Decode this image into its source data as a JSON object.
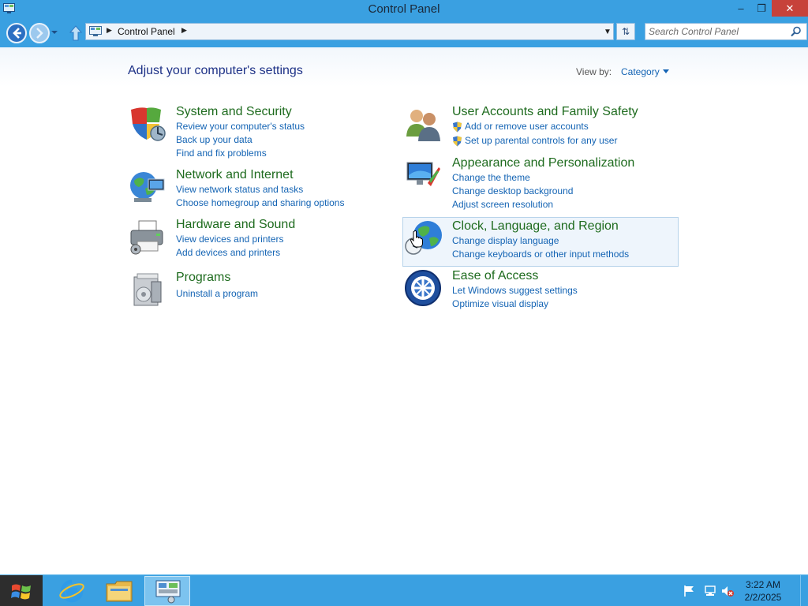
{
  "window": {
    "title": "Control Panel",
    "minimize_label": "–",
    "maximize_label": "❐",
    "close_label": "✕"
  },
  "address_bar": {
    "breadcrumb": [
      "Control Panel"
    ],
    "search_placeholder": "Search Control Panel"
  },
  "content": {
    "heading": "Adjust your computer's settings",
    "view_by_label": "View by:",
    "view_by_value": "Category",
    "categories": [
      {
        "title": "System and Security",
        "icon": "shield-icon",
        "links": [
          "Review your computer's status",
          "Back up your data",
          "Find and fix problems"
        ]
      },
      {
        "title": "Network and Internet",
        "icon": "network-globe-icon",
        "links": [
          "View network status and tasks",
          "Choose homegroup and sharing options"
        ]
      },
      {
        "title": "Hardware and Sound",
        "icon": "printer-icon",
        "links": [
          "View devices and printers",
          "Add devices and printers"
        ]
      },
      {
        "title": "Programs",
        "icon": "programs-icon",
        "links": [
          "Uninstall a program"
        ]
      },
      {
        "title": "User Accounts and Family Safety",
        "icon": "users-icon",
        "links": [
          "Add or remove user accounts",
          "Set up parental controls for any user"
        ]
      },
      {
        "title": "Appearance and Personalization",
        "icon": "monitor-paint-icon",
        "links": [
          "Change the theme",
          "Change desktop background",
          "Adjust screen resolution"
        ]
      },
      {
        "title": "Clock, Language, and Region",
        "icon": "globe-clock-icon",
        "links": [
          "Change display language",
          "Change keyboards or other input methods"
        ]
      },
      {
        "title": "Ease of Access",
        "icon": "ease-of-access-icon",
        "links": [
          "Let Windows suggest settings",
          "Optimize visual display"
        ]
      }
    ]
  },
  "taskbar": {
    "apps": [
      "internet-explorer-icon",
      "file-explorer-icon",
      "control-panel-icon"
    ],
    "tray_icons": [
      "flag-icon",
      "network-icon",
      "volume-muted-icon"
    ],
    "time": "3:22 AM",
    "date": "2/2/2025"
  },
  "colors": {
    "chrome_blue": "#3aa0e1",
    "link_blue": "#1464b4",
    "category_green": "#1e6b1e",
    "heading_navy": "#1e3287"
  }
}
